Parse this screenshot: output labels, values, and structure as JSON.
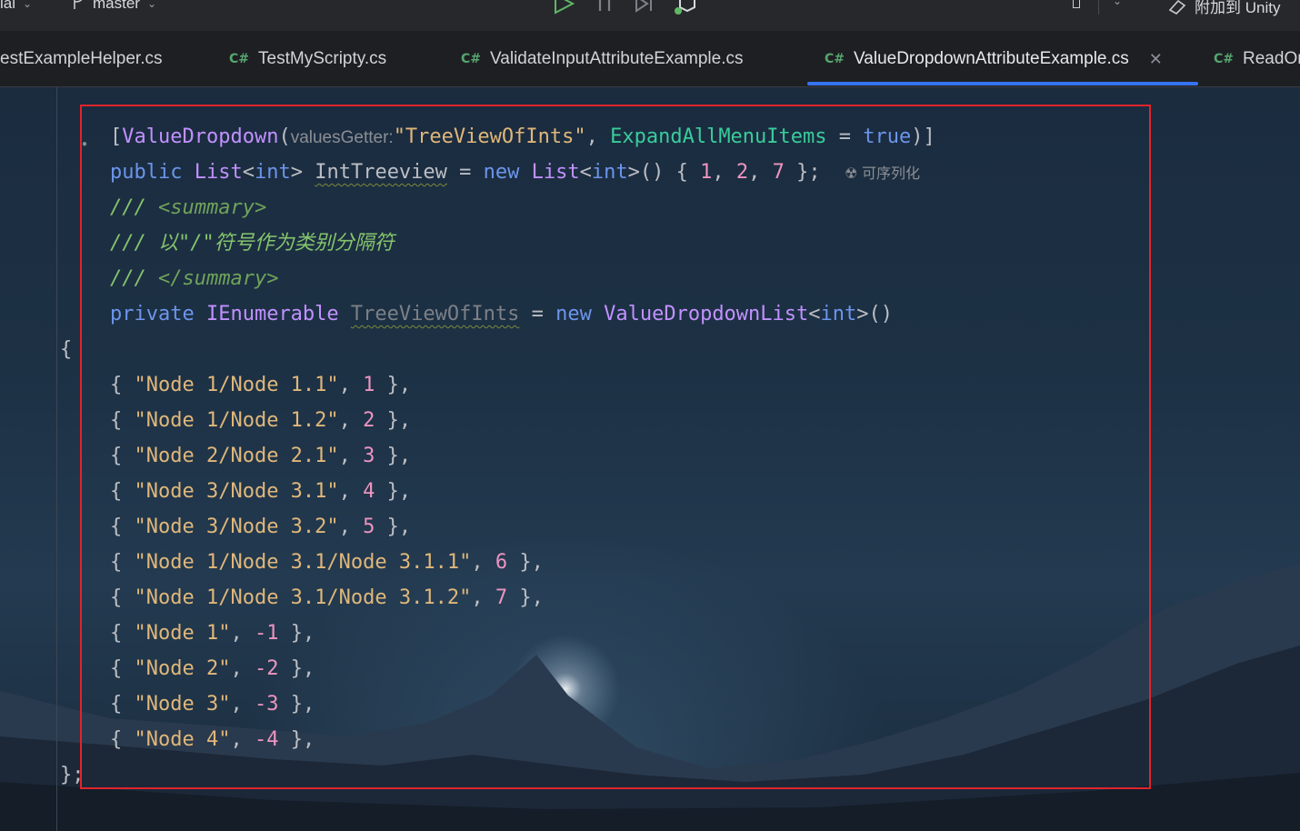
{
  "topbar": {
    "left_fragment": "ial",
    "branch": "master",
    "attach_label": "附加到 Unity"
  },
  "tabs": [
    {
      "icon": "",
      "label": "estExampleHelper.cs"
    },
    {
      "icon": "C#",
      "label": "TestMyScripty.cs"
    },
    {
      "icon": "C#",
      "label": "ValidateInputAttributeExample.cs"
    },
    {
      "icon": "C#",
      "label": "ValueDropdownAttributeExample.cs",
      "active": true
    },
    {
      "icon": "C#",
      "label": "ReadOn"
    }
  ],
  "code": {
    "l1": {
      "open": "[",
      "attr": "ValueDropdown",
      "paren": "(",
      "hint": "valuesGetter:",
      "str": "\"TreeViewOfInts\"",
      "comma": ", ",
      "named": "ExpandAllMenuItems",
      "eq": " = ",
      "val": "true",
      "close": ")]"
    },
    "l2": {
      "kw": "public",
      "type": "List",
      "gen_open": "<",
      "gen_type": "int",
      "gen_close": ">",
      "field": "IntTreeview",
      "eq": " = ",
      "new": "new",
      "type2": "List",
      "gen2": "int",
      "tail": ">() { ",
      "n1": "1",
      "n2": "2",
      "n3": "7",
      "end": " };",
      "hint": "可序列化"
    },
    "l3": {
      "slashes": "/// ",
      "tag": "<summary>"
    },
    "l4": {
      "text": "/// 以\"/\"符号作为类别分隔符"
    },
    "l5": {
      "slashes": "/// ",
      "tag": "</summary>"
    },
    "l6": {
      "kw": "private",
      "type": "IEnumerable",
      "field": "TreeViewOfInts",
      "eq": " = ",
      "new": "new",
      "type2": "ValueDropdownList",
      "gen": "int",
      "tail": "()"
    },
    "brace_open": "{",
    "entries": [
      {
        "str": "\"Node 1/Node 1.1\"",
        "num": "1"
      },
      {
        "str": "\"Node 1/Node 1.2\"",
        "num": "2"
      },
      {
        "str": "\"Node 2/Node 2.1\"",
        "num": "3"
      },
      {
        "str": "\"Node 3/Node 3.1\"",
        "num": "4"
      },
      {
        "str": "\"Node 3/Node 3.2\"",
        "num": "5"
      },
      {
        "str": "\"Node 1/Node 3.1/Node 3.1.1\"",
        "num": "6"
      },
      {
        "str": "\"Node 1/Node 3.1/Node 3.1.2\"",
        "num": "7"
      },
      {
        "str": "\"Node 1\"",
        "num": "-1"
      },
      {
        "str": "\"Node 2\"",
        "num": "-2"
      },
      {
        "str": "\"Node 3\"",
        "num": "-3"
      },
      {
        "str": "\"Node 4\"",
        "num": "-4"
      }
    ],
    "brace_close": "};"
  },
  "colors": {
    "accent": "#3574f0",
    "highlight": "#e0242c"
  }
}
